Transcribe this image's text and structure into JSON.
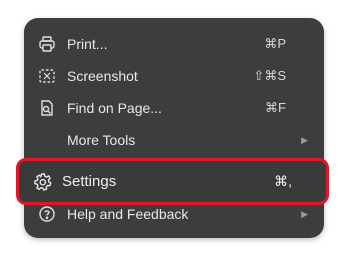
{
  "menu": {
    "items": [
      {
        "label": "Print...",
        "shortcut": "⌘P",
        "icon": "printer-icon"
      },
      {
        "label": "Screenshot",
        "shortcut": "⇧⌘S",
        "icon": "screenshot-icon"
      },
      {
        "label": "Find on Page...",
        "shortcut": "⌘F",
        "icon": "find-on-page-icon"
      },
      {
        "label": "More Tools",
        "submenu_arrow": "▶"
      },
      {
        "label": "Settings",
        "shortcut": "⌘,",
        "icon": "gear-icon"
      },
      {
        "label": "Help and Feedback",
        "submenu_arrow": "▶",
        "icon": "help-icon"
      }
    ]
  },
  "colors": {
    "menu_background": "#3d3d3d",
    "text": "#e8e8e8",
    "highlight_border": "#e0162b"
  }
}
